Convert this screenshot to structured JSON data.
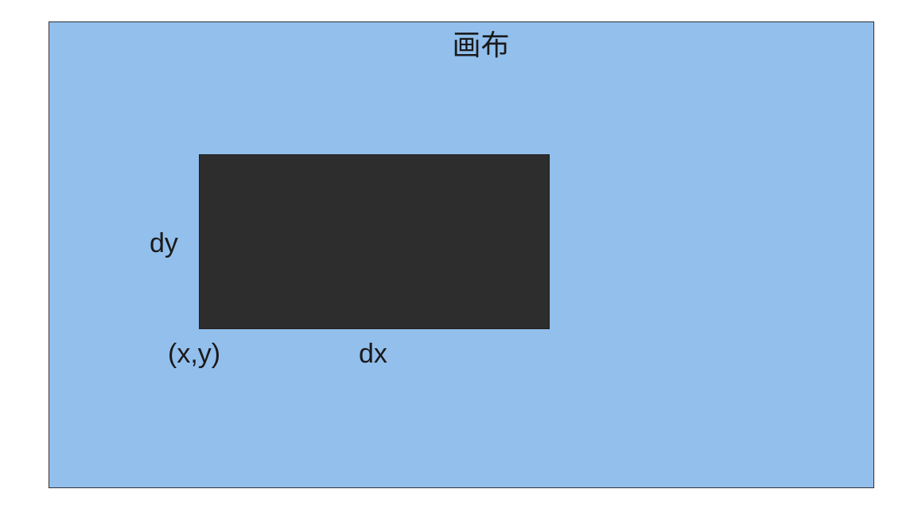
{
  "canvas": {
    "title": "画布",
    "fill_color": "#92bfec"
  },
  "rectangle": {
    "fill_color": "#2d2d2d",
    "origin_label": "(x,y)",
    "width_label": "dx",
    "height_label": "dy"
  }
}
